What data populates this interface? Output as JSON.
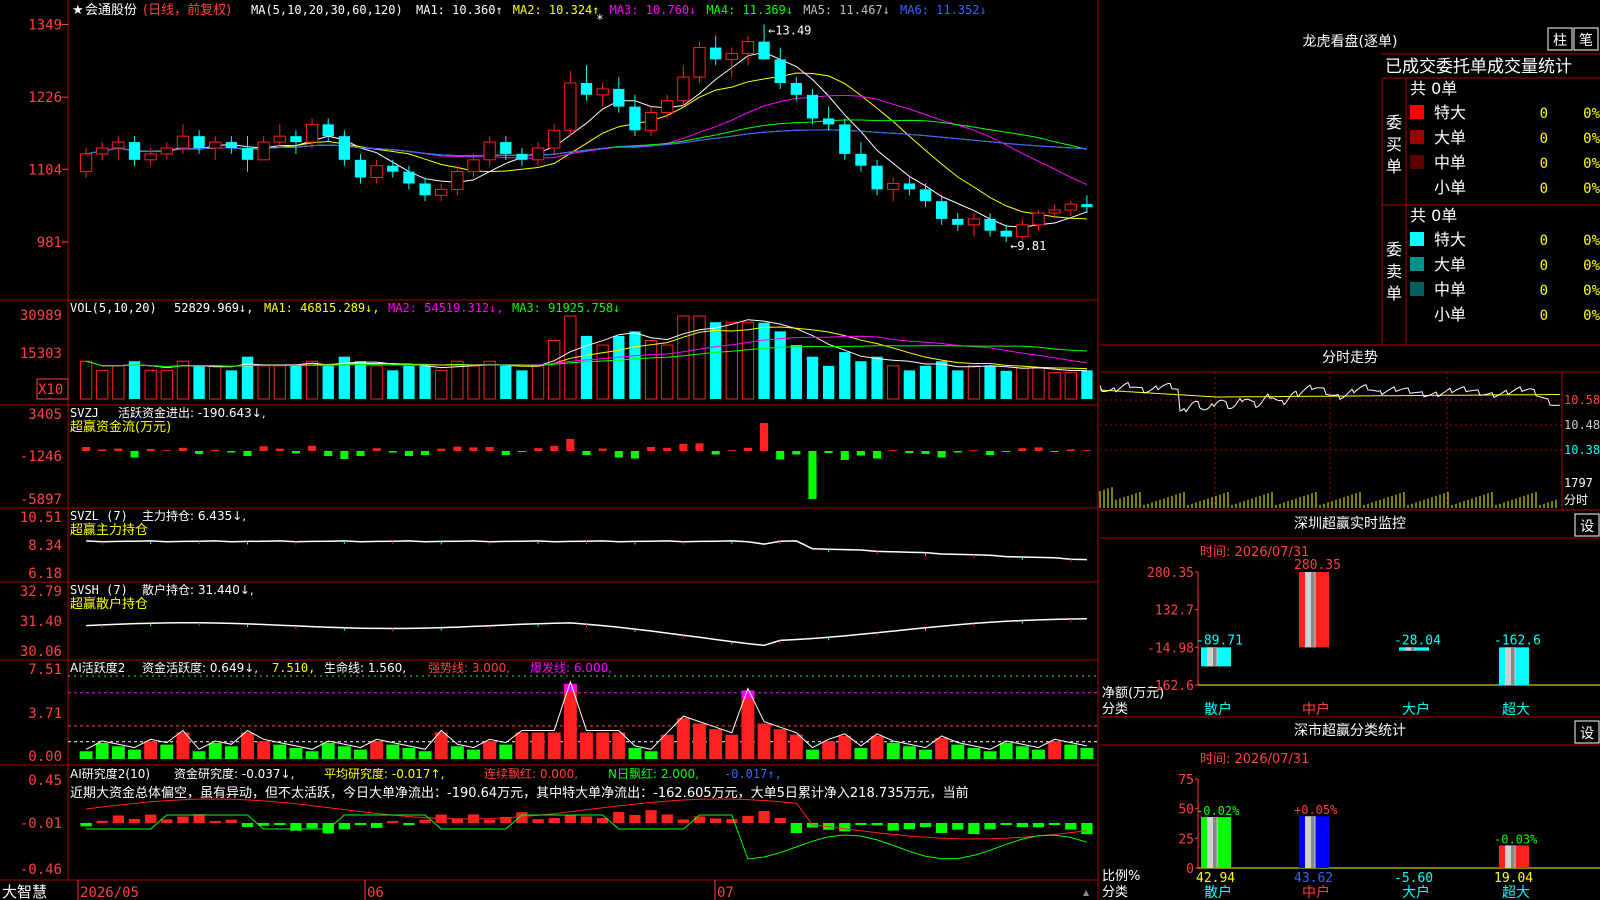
{
  "app": {
    "brand": "大智慧"
  },
  "colors": {
    "up": "#ff2020",
    "down": "#00ffff",
    "grid": "#b00000",
    "white": "#ffffff",
    "yellow": "#ffff00",
    "magenta": "#ff00ff",
    "green": "#00ff00",
    "blue": "#3366ff",
    "orange": "#ff8040"
  },
  "main_chart": {
    "title": "会通股份",
    "period": "(日线，前复权)",
    "ma_head": "MA(5,10,20,30,60,120)",
    "ma": [
      {
        "label": "MA1:",
        "value": "10.360",
        "arrow": "↑",
        "color": "#ffffff"
      },
      {
        "label": "MA2:",
        "value": "10.324",
        "arrow": "↑",
        "color": "#ffff00"
      },
      {
        "label": "MA3:",
        "value": "10.760",
        "arrow": "↓",
        "color": "#ff00ff"
      },
      {
        "label": "MA4:",
        "value": "11.369",
        "arrow": "↓",
        "color": "#00ff00"
      },
      {
        "label": "MA5:",
        "value": "11.467",
        "arrow": "↓",
        "color": "#c0c0c0"
      },
      {
        "label": "MA6:",
        "value": "11.352",
        "arrow": "↓",
        "color": "#3366ff"
      }
    ],
    "y_ticks": [
      "1349",
      "1226",
      "1104",
      "981"
    ],
    "high_label": "13.49",
    "low_label": "9.81"
  },
  "vol_panel": {
    "head": "VOL(5,10,20)",
    "value": "52829.969",
    "ma1": "MA1: 46815.289",
    "ma2": "MA2: 54519.312",
    "ma3": "MA3: 91925.758",
    "y_ticks": [
      "30989",
      "15303"
    ],
    "unit": "X10"
  },
  "svzj_panel": {
    "head": "SVZJ",
    "label": "活跃资金进出:",
    "value": "-190.643",
    "sub": "超赢资金流(万元)",
    "y_ticks": [
      "3405",
      "-1246",
      "-5897"
    ]
  },
  "svzl_panel": {
    "head": "SVZL (7)",
    "label": "主力持仓:",
    "value": "6.435",
    "sub": "超赢主力持仓",
    "y_ticks": [
      "10.51",
      "8.34",
      "6.18"
    ]
  },
  "svsh_panel": {
    "head": "SVSH (7)",
    "label": "散户持仓:",
    "value": "31.440",
    "sub": "超赢散户持仓",
    "y_ticks": [
      "32.79",
      "31.40",
      "30.06"
    ]
  },
  "ai_active_panel": {
    "head": "AI活跃度2",
    "label": "资金活跃度:",
    "value": "0.649",
    "v2": "7.510",
    "life_label": "生命线:",
    "life": "1.560",
    "strong": "强势线: 3.000",
    "burst": "爆发线: 6.000",
    "y_ticks": [
      "7.51",
      "3.71",
      "0.00"
    ]
  },
  "ai_research_panel": {
    "head": "AI研究度2(10)",
    "label": "资金研究度:",
    "value": "-0.037",
    "avg": "平均研究度: -0.017",
    "lianxu": "连续飘红: 0.000",
    "nday": "N日飘红: 2.000",
    "last": "-0.017",
    "commentary": "近期大资金总体偏空，虽有异动，但不太活跃，今日大单净流出：-190.64万元，其中特大单净流出：-162.605万元，大单5日累计净入218.735万元，当前",
    "y_ticks": [
      "0.45",
      "-0.01",
      "-0.46"
    ]
  },
  "x_axis": {
    "labels": [
      "2026/05",
      "06",
      "07"
    ]
  },
  "right_top": {
    "title": "龙虎看盘(逐单)",
    "btn1": "柱",
    "btn2": "笔",
    "tabs": "已成交委托单成交量统计",
    "buy_label": "委买单",
    "sell_label": "委卖单",
    "buy_total": "共 0单",
    "sell_total": "共 0单",
    "buy_rows": [
      {
        "name": "特大",
        "count": "0",
        "pct": "0%",
        "color": "#ff0000"
      },
      {
        "name": "大单",
        "count": "0",
        "pct": "0%",
        "color": "#a00000"
      },
      {
        "name": "中单",
        "count": "0",
        "pct": "0%",
        "color": "#600000"
      },
      {
        "name": "小单",
        "count": "0",
        "pct": "0%",
        "color": ""
      }
    ],
    "sell_rows": [
      {
        "name": "特大",
        "count": "0",
        "pct": "0%",
        "color": "#00ffff"
      },
      {
        "name": "大单",
        "count": "0",
        "pct": "0%",
        "color": "#009090"
      },
      {
        "name": "中单",
        "count": "0",
        "pct": "0%",
        "color": "#006060"
      },
      {
        "name": "小单",
        "count": "0",
        "pct": "0%",
        "color": ""
      }
    ]
  },
  "intraday": {
    "title": "分时走势",
    "y_ticks": [
      "10.58",
      "10.48",
      "10.38"
    ],
    "vol_label": "1797",
    "vol_unit": "分时"
  },
  "sz_monitor": {
    "title": "深圳超赢实时监控",
    "settings": "设",
    "time": "时间: 2026/07/31",
    "y_ticks": [
      "280.35",
      "132.7",
      "-14.98",
      "-162.6"
    ],
    "ylabel": "净额(万元)",
    "xlabel": "分类",
    "categories": [
      "散户",
      "中户",
      "大户",
      "超大"
    ],
    "values": [
      -89.71,
      280.35,
      -28.04,
      -162.6
    ],
    "value_labels": [
      "-89.71",
      "280.35",
      "-28.04",
      "-162.6"
    ]
  },
  "sz_class": {
    "title": "深市超赢分类统计",
    "settings": "设",
    "time": "时间: 2026/07/31",
    "y_ticks": [
      "75",
      "50",
      "25",
      "0"
    ],
    "ylabel": "比例%",
    "xlabel": "分类",
    "categories": [
      "散户",
      "中户",
      "大户",
      "超大"
    ],
    "top_labels": [
      "-0.02%",
      "+0.05%",
      "",
      "-0.03%"
    ],
    "values": [
      42.94,
      43.62,
      -5.6,
      19.04
    ],
    "value_labels": [
      "42.94",
      "43.62",
      "-5.60",
      "19.04"
    ]
  },
  "chart_data": [
    {
      "type": "candlestick",
      "title": "会通股份 (日线，前复权)",
      "x_labels": [
        "2026/05",
        "06",
        "07"
      ],
      "ylim": [
        9.2,
        13.6
      ],
      "ohlc": [
        [
          11.0,
          11.4,
          10.9,
          11.3
        ],
        [
          11.3,
          11.5,
          11.2,
          11.4
        ],
        [
          11.4,
          11.6,
          11.2,
          11.5
        ],
        [
          11.5,
          11.6,
          11.1,
          11.2
        ],
        [
          11.2,
          11.4,
          11.1,
          11.3
        ],
        [
          11.3,
          11.5,
          11.2,
          11.4
        ],
        [
          11.4,
          11.8,
          11.3,
          11.6
        ],
        [
          11.6,
          11.7,
          11.3,
          11.4
        ],
        [
          11.4,
          11.6,
          11.2,
          11.5
        ],
        [
          11.5,
          11.6,
          11.3,
          11.4
        ],
        [
          11.4,
          11.6,
          11.0,
          11.2
        ],
        [
          11.2,
          11.6,
          11.2,
          11.5
        ],
        [
          11.5,
          11.8,
          11.4,
          11.6
        ],
        [
          11.6,
          11.7,
          11.3,
          11.5
        ],
        [
          11.5,
          11.9,
          11.4,
          11.8
        ],
        [
          11.8,
          11.9,
          11.5,
          11.6
        ],
        [
          11.6,
          11.7,
          11.1,
          11.2
        ],
        [
          11.2,
          11.3,
          10.8,
          10.9
        ],
        [
          10.9,
          11.2,
          10.8,
          11.1
        ],
        [
          11.1,
          11.2,
          10.9,
          11.0
        ],
        [
          11.0,
          11.1,
          10.7,
          10.8
        ],
        [
          10.8,
          10.9,
          10.5,
          10.6
        ],
        [
          10.6,
          10.8,
          10.5,
          10.7
        ],
        [
          10.7,
          11.1,
          10.6,
          11.0
        ],
        [
          11.0,
          11.3,
          10.9,
          11.2
        ],
        [
          11.2,
          11.6,
          11.1,
          11.5
        ],
        [
          11.5,
          11.6,
          11.2,
          11.3
        ],
        [
          11.3,
          11.4,
          11.1,
          11.2
        ],
        [
          11.2,
          11.5,
          11.1,
          11.4
        ],
        [
          11.4,
          11.8,
          11.3,
          11.7
        ],
        [
          11.7,
          12.7,
          11.6,
          12.5
        ],
        [
          12.5,
          12.8,
          12.2,
          12.3
        ],
        [
          12.3,
          12.5,
          12.1,
          12.4
        ],
        [
          12.4,
          12.6,
          12.0,
          12.1
        ],
        [
          12.1,
          12.3,
          11.6,
          11.7
        ],
        [
          11.7,
          12.1,
          11.6,
          12.0
        ],
        [
          12.0,
          12.3,
          11.9,
          12.2
        ],
        [
          12.2,
          12.8,
          12.1,
          12.6
        ],
        [
          12.6,
          13.2,
          12.5,
          13.1
        ],
        [
          13.1,
          13.3,
          12.8,
          12.9
        ],
        [
          12.9,
          13.1,
          12.6,
          13.0
        ],
        [
          13.0,
          13.3,
          12.8,
          13.2
        ],
        [
          13.2,
          13.49,
          13.0,
          12.9
        ],
        [
          12.9,
          13.1,
          12.4,
          12.5
        ],
        [
          12.5,
          12.6,
          12.2,
          12.3
        ],
        [
          12.3,
          12.4,
          11.8,
          11.9
        ],
        [
          11.9,
          12.1,
          11.7,
          11.8
        ],
        [
          11.8,
          11.9,
          11.2,
          11.3
        ],
        [
          11.3,
          11.5,
          11.0,
          11.1
        ],
        [
          11.1,
          11.2,
          10.6,
          10.7
        ],
        [
          10.7,
          10.9,
          10.5,
          10.8
        ],
        [
          10.8,
          10.9,
          10.6,
          10.7
        ],
        [
          10.7,
          10.8,
          10.4,
          10.5
        ],
        [
          10.5,
          10.6,
          10.1,
          10.2
        ],
        [
          10.2,
          10.3,
          10.0,
          10.1
        ],
        [
          10.1,
          10.3,
          9.9,
          10.2
        ],
        [
          10.2,
          10.3,
          9.9,
          10.0
        ],
        [
          10.0,
          10.1,
          9.81,
          9.9
        ],
        [
          9.9,
          10.2,
          9.85,
          10.1
        ],
        [
          10.1,
          10.35,
          10.0,
          10.3
        ],
        [
          10.3,
          10.45,
          10.2,
          10.35
        ],
        [
          10.35,
          10.5,
          10.25,
          10.45
        ],
        [
          10.45,
          10.6,
          10.3,
          10.4
        ]
      ]
    },
    {
      "type": "bar",
      "title": "深圳超赢实时监控",
      "categories": [
        "散户",
        "中户",
        "大户",
        "超大"
      ],
      "values": [
        -89.71,
        280.35,
        -28.04,
        -162.6
      ],
      "ylabel": "净额(万元)",
      "ylim": [
        -162.6,
        280.35
      ]
    },
    {
      "type": "bar",
      "title": "深市超赢分类统计",
      "categories": [
        "散户",
        "中户",
        "大户",
        "超大"
      ],
      "values": [
        42.94,
        43.62,
        -5.6,
        19.04
      ],
      "ylabel": "比例%",
      "ylim": [
        0,
        75
      ]
    }
  ]
}
